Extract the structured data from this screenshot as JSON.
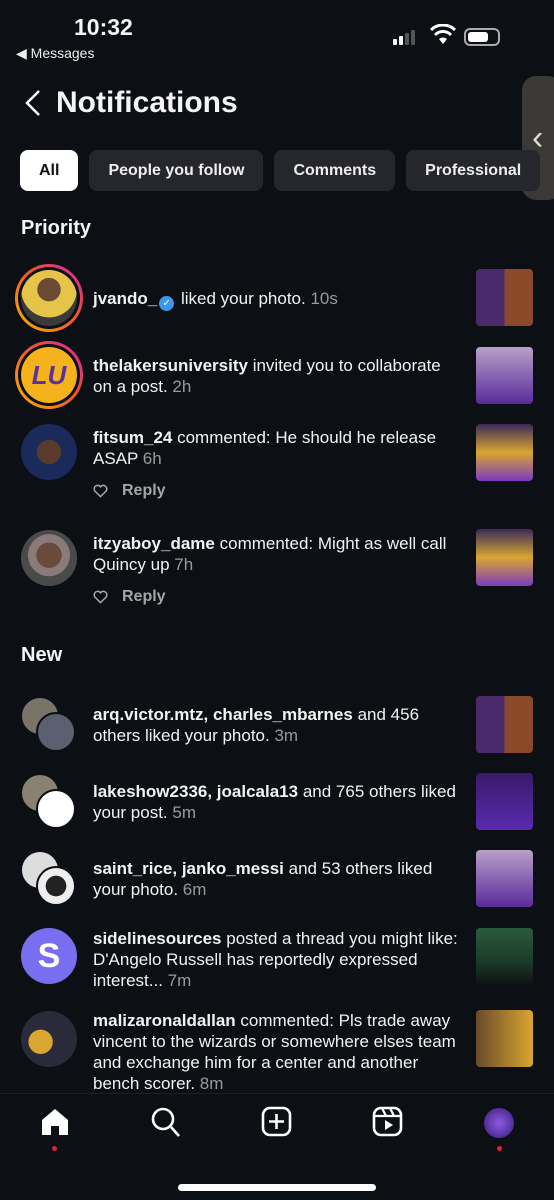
{
  "status_bar": {
    "time": "10:32",
    "back_app": "◀ Messages"
  },
  "header": {
    "title": "Notifications"
  },
  "filters": [
    {
      "label": "All",
      "active": true
    },
    {
      "label": "People you follow"
    },
    {
      "label": "Comments"
    },
    {
      "label": "Professional"
    }
  ],
  "sections": {
    "priority": "Priority",
    "new": "New"
  },
  "reply_label": "Reply",
  "priority": [
    {
      "actor": "jvando_",
      "verified": true,
      "text": " liked your photo.",
      "time": "10s"
    },
    {
      "actor": "thelakersuniversity",
      "text": " invited you to collaborate on a post.",
      "time": "2h",
      "avatar_text": "LU"
    },
    {
      "actor": "fitsum_24",
      "text": " commented: He should he release ASAP",
      "time": "6h"
    },
    {
      "actor": "itzyaboy_dame",
      "text": " commented: Might as well call Quincy up",
      "time": "7h"
    }
  ],
  "new": [
    {
      "actor": "arq.victor.mtz, charles_mbarnes",
      "text": " and 456 others liked your photo.",
      "time": "3m"
    },
    {
      "actor": "lakeshow2336, joalcala13",
      "text": " and 765 others liked your post.",
      "time": "5m"
    },
    {
      "actor": "saint_rice, janko_messi",
      "text": " and 53 others liked your photo.",
      "time": "6m"
    },
    {
      "actor": "sidelinesources",
      "text": " posted a thread you might like: D'Angelo Russell has reportedly expressed interest...",
      "time": "7m"
    },
    {
      "actor": "malizaronaldallan",
      "text": " commented: Pls trade away vincent to the wizards or somewhere elses team and exchange him for a center and another bench scorer. ",
      "time": "8m"
    }
  ],
  "nav": [
    "home-icon",
    "search-icon",
    "create-icon",
    "reels-icon",
    "profile-avatar"
  ],
  "colors": {
    "background": "#0c0f14",
    "chip": "#25272c",
    "verified": "#3897f0",
    "notification_dot": "#e0203a"
  }
}
